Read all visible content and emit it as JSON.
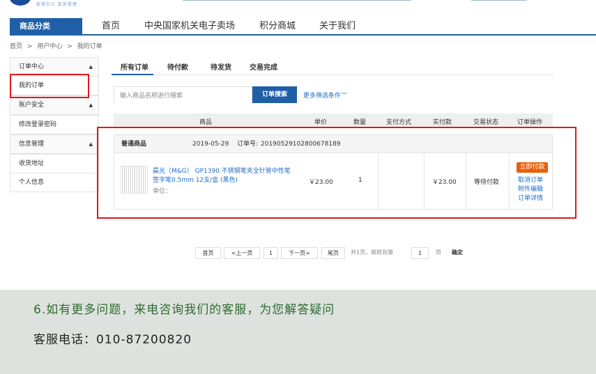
{
  "header": {
    "tagline": "智慧办公 智慧管理"
  },
  "nav": {
    "category": "商品分类",
    "items": [
      "首页",
      "中央国家机关电子卖场",
      "积分商城",
      "关于我们"
    ]
  },
  "breadcrumb": [
    "首页",
    ">",
    "用户中心",
    ">",
    "我的订单"
  ],
  "sidebar": {
    "items": [
      {
        "label": "订单中心",
        "caret": "▲"
      },
      {
        "label": "我的订单"
      },
      {
        "label": "账户安全",
        "caret": "▲"
      },
      {
        "label": "修改登录密码"
      },
      {
        "label": "信息管理",
        "caret": "▲"
      },
      {
        "label": "收货地址"
      },
      {
        "label": "个人信息"
      }
    ]
  },
  "tabs": [
    "所有订单",
    "待付款",
    "待发货",
    "交易完成"
  ],
  "search": {
    "placeholder": "输入商品名称进行搜索",
    "button": "订单搜索",
    "more_filters": "更多筛选条件"
  },
  "table": {
    "headers": [
      "商品",
      "单价",
      "数量",
      "支付方式",
      "实付款",
      "交易状态",
      "订单操作"
    ]
  },
  "order": {
    "type": "普通商品",
    "date": "2019-05-29",
    "number_label": "订单号:",
    "number": "20190529102800678189",
    "product_title": "晨光（M&G） GP1390 不锈钢笔夹全针管中性笔签字笔0.5mm 12支/盒 (黑色)",
    "unit_label": "单位：",
    "price": "￥23.00",
    "quantity": "1",
    "paid": "￥23.00",
    "status": "等待付款",
    "actions": {
      "pay_now": "立即付款",
      "cancel": "取消订单",
      "attachment": "附件编辑",
      "detail": "订单详情"
    }
  },
  "pagination": {
    "first": "首页",
    "prev": "<上一页",
    "current": "1",
    "next": "下一页>",
    "last": "尾页",
    "total_text": "共1页，跳转到第",
    "jump_value": "1",
    "page_unit": "页",
    "confirm": "确定"
  },
  "footer": {
    "question": "6.如有更多问题，来电咨询我们的客服，为您解答疑问",
    "phone": "客服电话：010-87200820"
  },
  "colors": {
    "brand_blue": "#1f5fa8",
    "link_blue": "#1f6fc9",
    "highlight_red": "#e0171c",
    "pay_orange": "#e8600c",
    "footer_bg": "#dde2df",
    "footer_green": "#2d6b2d"
  }
}
